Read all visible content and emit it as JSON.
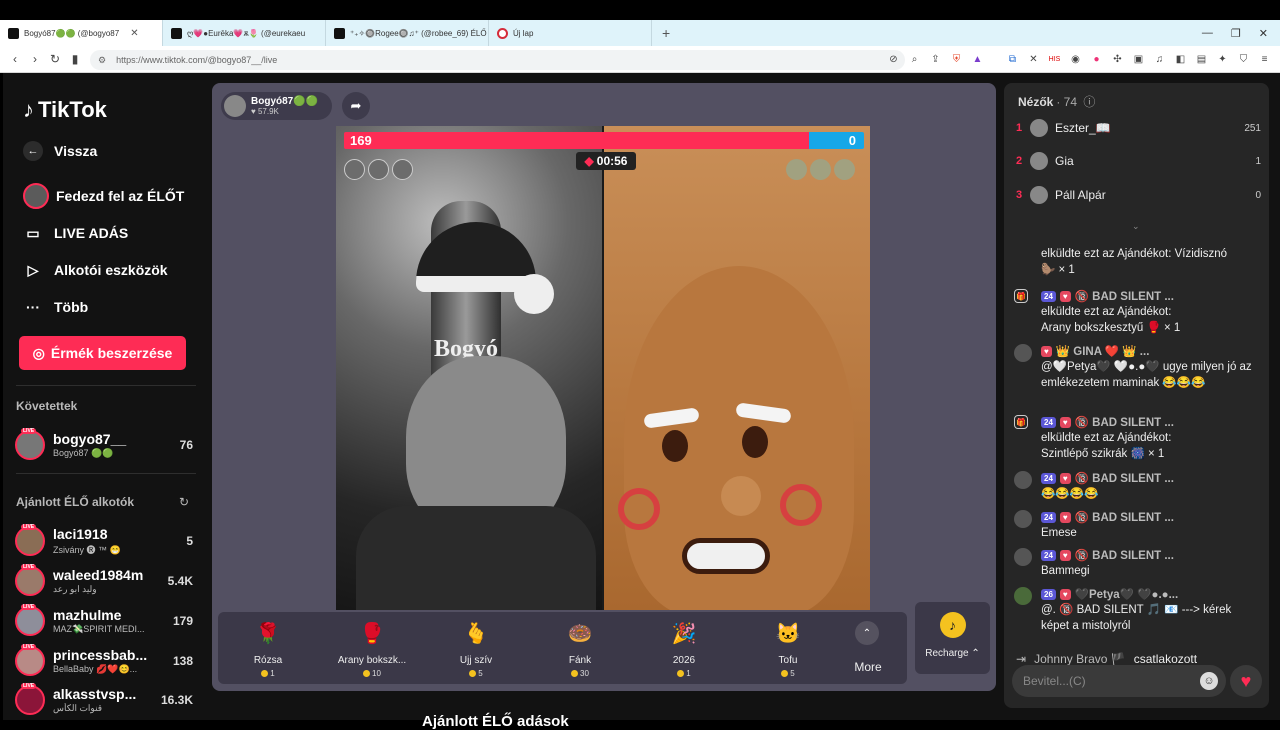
{
  "browser": {
    "tabs": [
      {
        "label": "Bogyó87🟢🟢 (@bogyo87",
        "active": true
      },
      {
        "label": "ღ💗●Eurēka💗ѫ🌷 (@eurekaeu",
        "active": false
      },
      {
        "label": "⁺₊✧🔘Rogee🔘♫⁺ (@robee_69) ÉLŐ ×",
        "active": false
      },
      {
        "label": "Új lap",
        "active": false
      }
    ],
    "url": "https://www.tiktok.com/@bogyo87__/live"
  },
  "sidebar": {
    "logo": "TikTok",
    "nav": [
      {
        "label": "Vissza",
        "icon": "back-arrow-icon"
      },
      {
        "label": "Fedezd fel az ÉLŐT",
        "icon": "avatar-icon"
      },
      {
        "label": "LIVE ADÁS",
        "icon": "camera-icon"
      },
      {
        "label": "Alkotói eszközök",
        "icon": "creator-tools-icon"
      },
      {
        "label": "Több",
        "icon": "more-icon"
      }
    ],
    "coin_button": "Érmék beszerzése",
    "following_title": "Követettek",
    "following": [
      {
        "name": "bogyo87__",
        "sub": "Bogyó87 🟢🟢",
        "value": "76"
      }
    ],
    "recommended_title": "Ajánlott ÉLŐ alkotók",
    "recommended": [
      {
        "name": "laci1918",
        "sub": "Zsivány 🅡 ™ 😁",
        "value": "5"
      },
      {
        "name": "waleed1984m",
        "sub": "وليد ابو رعد",
        "value": "5.4K"
      },
      {
        "name": "mazhulme",
        "sub": "MAZ💸SPIRIT MEDI...",
        "value": "179"
      },
      {
        "name": "princessbab...",
        "sub": "BellaBaby 💋❤️😊...",
        "value": "138"
      },
      {
        "name": "alkasstvsp...",
        "sub": "قنوات الكأس",
        "value": "16.3K"
      }
    ],
    "live_badge": "LIVE"
  },
  "stream": {
    "host_name": "Bogyó87🟢🟢",
    "host_likes": "57.9K",
    "score_left": "169",
    "score_right": "0",
    "timer": "00:56",
    "ornament_text": "Bogyó",
    "below_title": "Ajánlott ÉLŐ adások"
  },
  "gifts": [
    {
      "name": "Rózsa",
      "price": "1",
      "icon": "🌹"
    },
    {
      "name": "Arany bokszk...",
      "price": "10",
      "icon": "🥊"
    },
    {
      "name": "Ujj szív",
      "price": "5",
      "icon": "🫰"
    },
    {
      "name": "Fánk",
      "price": "30",
      "icon": "🍩"
    },
    {
      "name": "2026",
      "price": "1",
      "icon": "🎉"
    },
    {
      "name": "Tofu",
      "price": "5",
      "icon": "🐱"
    }
  ],
  "gift_more": "More",
  "recharge": "Recharge",
  "chat": {
    "viewers_title": "Nézők",
    "viewers_count": "· 74",
    "top_viewers": [
      {
        "rank": "1",
        "name": "Eszter_📖",
        "value": "251"
      },
      {
        "rank": "2",
        "name": "Gia",
        "value": "1"
      },
      {
        "rank": "3",
        "name": "Páll Alpár",
        "value": "0"
      }
    ],
    "messages": [
      {
        "head": "",
        "text": "elküldte ezt az Ajándékot: Vízidisznó",
        "tail": "× 1",
        "type": "gift"
      },
      {
        "head": "🔞 BAD SILENT ...",
        "badge": "24",
        "text": "elküldte ezt az Ajándékot:",
        "text2": "Arany bokszkesztyű 🥊 × 1",
        "type": "gift"
      },
      {
        "head": "👑 GINA ❤️ 👑 ...",
        "text": "@🤍Petya🖤 🤍●.●🖤 ugye milyen jó az emlékezetem maminak 😂😂😂",
        "type": "user"
      },
      {
        "head": "🔞 BAD SILENT ...",
        "badge": "24",
        "text": "elküldte ezt az Ajándékot:",
        "text2": "Szintlépő szikrák 🎆 × 1",
        "type": "gift"
      },
      {
        "head": "🔞 BAD SILENT ...",
        "badge": "24",
        "text": "😂😂😂😂",
        "type": "user"
      },
      {
        "head": "🔞 BAD SILENT ...",
        "badge": "24",
        "text": "Emese",
        "type": "user"
      },
      {
        "head": "🔞 BAD SILENT ...",
        "badge": "24",
        "text": "Bammegi",
        "type": "user"
      },
      {
        "head": "🖤Petya🖤 🖤●.●...",
        "badge": "26",
        "text": "@. 🔞 BAD SILENT 🎵 📧 ---> kérek képet a mistolyról",
        "type": "user"
      }
    ],
    "join_name": "Johnny Bravo 🏴",
    "join_text": "csatlakozott",
    "input_placeholder": "Bevitel...(C)"
  }
}
